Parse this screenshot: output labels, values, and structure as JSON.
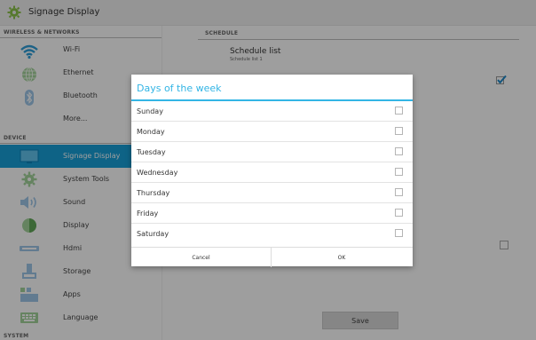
{
  "window": {
    "title": "Signage Display"
  },
  "sidebar": {
    "sections": {
      "wireless": "WIRELESS & NETWORKS",
      "device": "DEVICE",
      "system": "SYSTEM"
    },
    "items": [
      {
        "label": "Wi-Fi",
        "icon": "wifi-icon"
      },
      {
        "label": "Ethernet",
        "icon": "globe-icon"
      },
      {
        "label": "Bluetooth",
        "icon": "bluetooth-icon"
      },
      {
        "label": "More...",
        "icon": ""
      },
      {
        "label": "Signage Display",
        "icon": "display-icon",
        "selected": true
      },
      {
        "label": "System Tools",
        "icon": "gear-icon"
      },
      {
        "label": "Sound",
        "icon": "speaker-icon"
      },
      {
        "label": "Display",
        "icon": "brightness-icon"
      },
      {
        "label": "Hdmi",
        "icon": "hdmi-icon"
      },
      {
        "label": "Storage",
        "icon": "storage-icon"
      },
      {
        "label": "Apps",
        "icon": "apps-icon"
      },
      {
        "label": "Language",
        "icon": "keyboard-icon"
      }
    ]
  },
  "content": {
    "section": "SCHEDULE",
    "schedule_list_title": "Schedule list",
    "schedule_list_sub": "Schedule list 1",
    "save_label": "Save"
  },
  "dialog": {
    "title": "Days of the week",
    "days": [
      "Sunday",
      "Monday",
      "Tuesday",
      "Wednesday",
      "Thursday",
      "Friday",
      "Saturday"
    ],
    "cancel_label": "Cancel",
    "ok_label": "OK"
  },
  "colors": {
    "accent": "#33b5e5",
    "selected_bg": "#17a0d8"
  }
}
